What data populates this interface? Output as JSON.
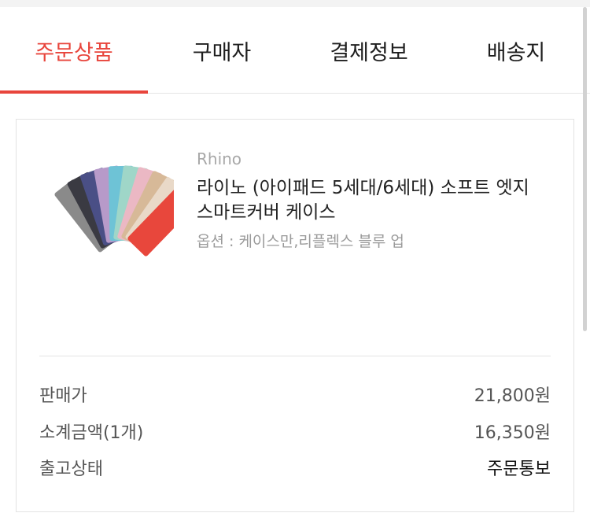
{
  "tabs": [
    {
      "label": "주문상품",
      "active": true
    },
    {
      "label": "구매자",
      "active": false
    },
    {
      "label": "결제정보",
      "active": false
    },
    {
      "label": "배송지",
      "active": false
    }
  ],
  "product": {
    "brand": "Rhino",
    "name": "라이노 (아이패드 5세대/6세대) 소프트 엣지 스마트커버 케이스",
    "option": "옵션 : 케이스만,리플렉스 블루 업",
    "image": "product-thumbnail"
  },
  "summary": [
    {
      "label": "판매가",
      "value": "21,800원"
    },
    {
      "label": "소계금액(1개)",
      "value": "16,350원"
    },
    {
      "label": "출고상태",
      "value": "주문통보"
    }
  ],
  "colors": {
    "accent": "#e8453c",
    "muted": "#a8a8a8",
    "border": "#e3e3e3"
  }
}
